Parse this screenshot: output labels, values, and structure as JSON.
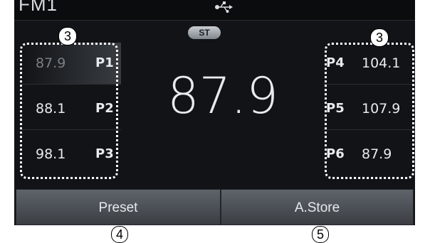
{
  "header": {
    "band_label": "FM1",
    "usb_icon": "usb-icon"
  },
  "status": {
    "stereo_badge": "ST"
  },
  "now_playing": {
    "frequency": "87.9"
  },
  "presets_left": [
    {
      "freq": "87.9",
      "num": "P1",
      "active": true
    },
    {
      "freq": "88.1",
      "num": "P2",
      "active": false
    },
    {
      "freq": "98.1",
      "num": "P3",
      "active": false
    }
  ],
  "presets_right": [
    {
      "num": "P4",
      "freq": "104.1"
    },
    {
      "num": "P5",
      "freq": "107.9"
    },
    {
      "num": "P6",
      "freq": "87.9"
    }
  ],
  "buttons": {
    "preset_label": "Preset",
    "astore_label": "A.Store"
  },
  "callouts": {
    "left_presets": "3",
    "right_presets": "3",
    "preset_button": "4",
    "astore_button": "5"
  }
}
